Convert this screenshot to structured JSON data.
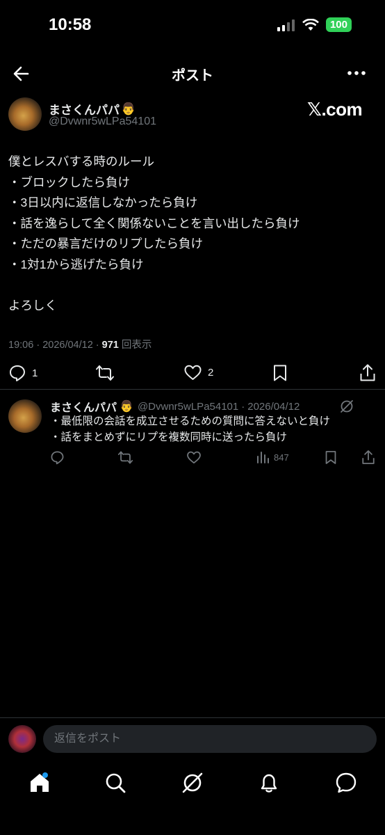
{
  "status_bar": {
    "time": "10:58",
    "battery": "100"
  },
  "header": {
    "title": "ポスト"
  },
  "post": {
    "author_name": "まさくんパパ",
    "author_emoji": "👨",
    "handle": "@Dvwnr5wLPa54101",
    "watermark": "𝕏.com",
    "text": "僕とレスバする時のルール\n・ブロックしたら負け\n・3日以内に返信しなかったら負け\n・話を逸らして全く関係ないことを言い出したら負け\n・ただの暴言だけのリプしたら負け\n・1対1から逃げたら負け\n\nよろしく",
    "time": "19:06",
    "date": "2026/04/12",
    "views": "971",
    "views_label": "回表示",
    "reply_count": "1",
    "like_count": "2"
  },
  "reply": {
    "author_name": "まさくんパパ",
    "author_emoji": "👨",
    "handle": "@Dvwnr5wLPa54101",
    "date": "2026/04/12",
    "text": "・最低限の会話を成立させるための質問に答えないと負け\n・話をまとめずにリプを複数同時に送ったら負け",
    "views": "847"
  },
  "compose": {
    "placeholder": "返信をポスト"
  },
  "tab_bar": {
    "items": [
      "home-icon",
      "search-icon",
      "grok-icon",
      "notifications-icon",
      "messages-icon"
    ]
  },
  "colors": {
    "accent": "#1d9bf0",
    "muted": "#71767b",
    "battery": "#30d158"
  }
}
